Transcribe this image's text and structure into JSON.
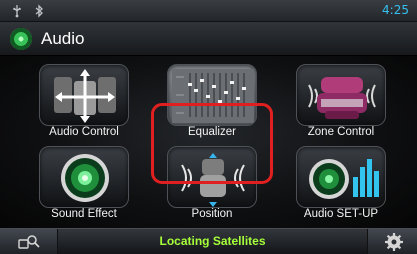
{
  "status_bar": {
    "time": "4:25",
    "icons": [
      "usb-icon",
      "bluetooth-icon"
    ],
    "time_color": "#35c0f0"
  },
  "header": {
    "title": "Audio",
    "icon": "audio-speaker-icon"
  },
  "menu": {
    "items": [
      {
        "label": "Audio Control",
        "icon": "audio-control-icon"
      },
      {
        "label": "Equalizer",
        "icon": "equalizer-icon",
        "selected": true
      },
      {
        "label": "Zone Control",
        "icon": "zone-control-icon"
      },
      {
        "label": "Sound Effect",
        "icon": "sound-effect-icon"
      },
      {
        "label": "Position",
        "icon": "position-icon"
      },
      {
        "label": "Audio SET-UP",
        "icon": "audio-setup-icon"
      }
    ],
    "highlight_color": "#e02020"
  },
  "bottom_bar": {
    "status_text": "Locating Satellites",
    "status_color": "#a6ff39",
    "left_icon": "navigation-search-icon",
    "right_icon": "settings-gear-icon"
  }
}
